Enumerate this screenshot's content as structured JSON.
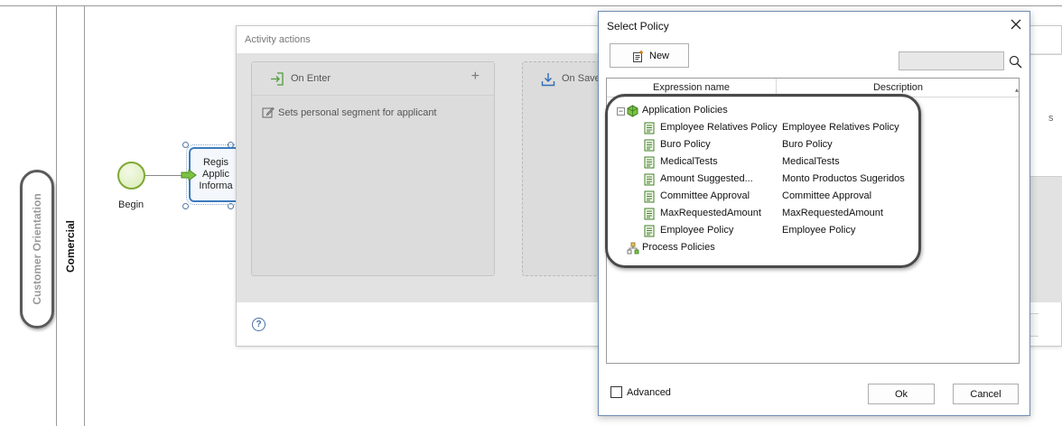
{
  "process": {
    "pool_label": "Customer Orientation",
    "lane_label": "Comercial",
    "start_event_label": "Begin",
    "task_lines": [
      "Regis",
      "Applic",
      "Informa"
    ]
  },
  "activity_actions": {
    "title": "Activity actions",
    "on_enter": {
      "label": "On Enter",
      "add_glyph": "+",
      "action_item": "Sets personal segment for applicant"
    },
    "on_save": {
      "label": "On Save"
    },
    "help_glyph": "?",
    "right_strip_text": "s"
  },
  "select_policy": {
    "title": "Select Policy",
    "new_button": "New",
    "search": {
      "value": "",
      "placeholder": ""
    },
    "columns": {
      "name": "Expression name",
      "description": "Description"
    },
    "tree": {
      "application_group": "Application Policies",
      "application_items": [
        {
          "name": "Employee Relatives Policy",
          "description": "Employee Relatives Policy"
        },
        {
          "name": "Buro Policy",
          "description": "Buro Policy"
        },
        {
          "name": "MedicalTests",
          "description": "MedicalTests"
        },
        {
          "name": "Amount Suggested...",
          "description": "Monto Productos Sugeridos"
        },
        {
          "name": "Committee Approval",
          "description": "Committee Approval"
        },
        {
          "name": "MaxRequestedAmount",
          "description": "MaxRequestedAmount"
        },
        {
          "name": "Employee Policy",
          "description": "Employee Policy"
        }
      ],
      "process_group": "Process Policies",
      "expander_glyph": "−"
    },
    "advanced_label": "Advanced",
    "advanced_checked": false,
    "ok_button": "Ok",
    "cancel_button": "Cancel"
  },
  "colors": {
    "accent_blue": "#3c7bbf",
    "start_event_green": "#7fa834",
    "dialog_border": "#6f8db5"
  }
}
